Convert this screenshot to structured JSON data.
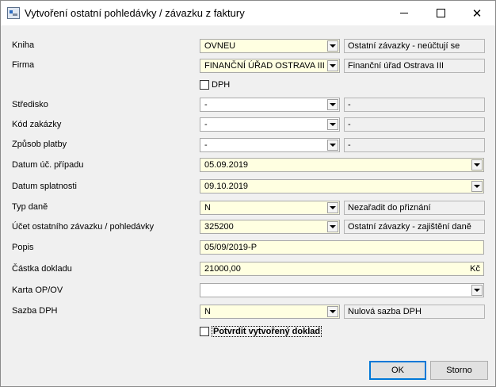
{
  "window": {
    "title": "Vytvoření ostatní pohledávky / závazku z faktury"
  },
  "form": {
    "kniha": {
      "label": "Kniha",
      "value": "OVNEU",
      "desc": "Ostatní závazky - neúčtují se"
    },
    "firma": {
      "label": "Firma",
      "value": "FINANČNÍ ÚŘAD OSTRAVA III",
      "desc": "Finanční úřad Ostrava III"
    },
    "dph": {
      "label": "DPH"
    },
    "stredisko": {
      "label": "Středisko",
      "value": "-",
      "desc": "-"
    },
    "kod_zakazky": {
      "label": "Kód zakázky",
      "value": "-",
      "desc": "-"
    },
    "zpusob_platby": {
      "label": "Způsob platby",
      "value": "-",
      "desc": "-"
    },
    "datum_uc": {
      "label": "Datum úč. případu",
      "value": "05.09.2019"
    },
    "datum_splatnosti": {
      "label": "Datum splatnosti",
      "value": "09.10.2019"
    },
    "typ_dane": {
      "label": "Typ daně",
      "value": "N",
      "desc": "Nezařadit do přiznání"
    },
    "ucet": {
      "label": "Účet ostatního závazku / pohledávky",
      "value": "325200",
      "desc": "Ostatní závazky - zajištění daně"
    },
    "popis": {
      "label": "Popis",
      "value": "05/09/2019-P"
    },
    "castka": {
      "label": "Částka dokladu",
      "value": "21000,00",
      "unit": "Kč"
    },
    "karta": {
      "label": "Karta OP/OV",
      "value": ""
    },
    "sazba": {
      "label": "Sazba DPH",
      "value": "N",
      "desc": "Nulová sazba DPH"
    },
    "potvrdit": {
      "label": "Potvrdit vytvořený doklad"
    }
  },
  "buttons": {
    "ok": "OK",
    "storno": "Storno"
  }
}
